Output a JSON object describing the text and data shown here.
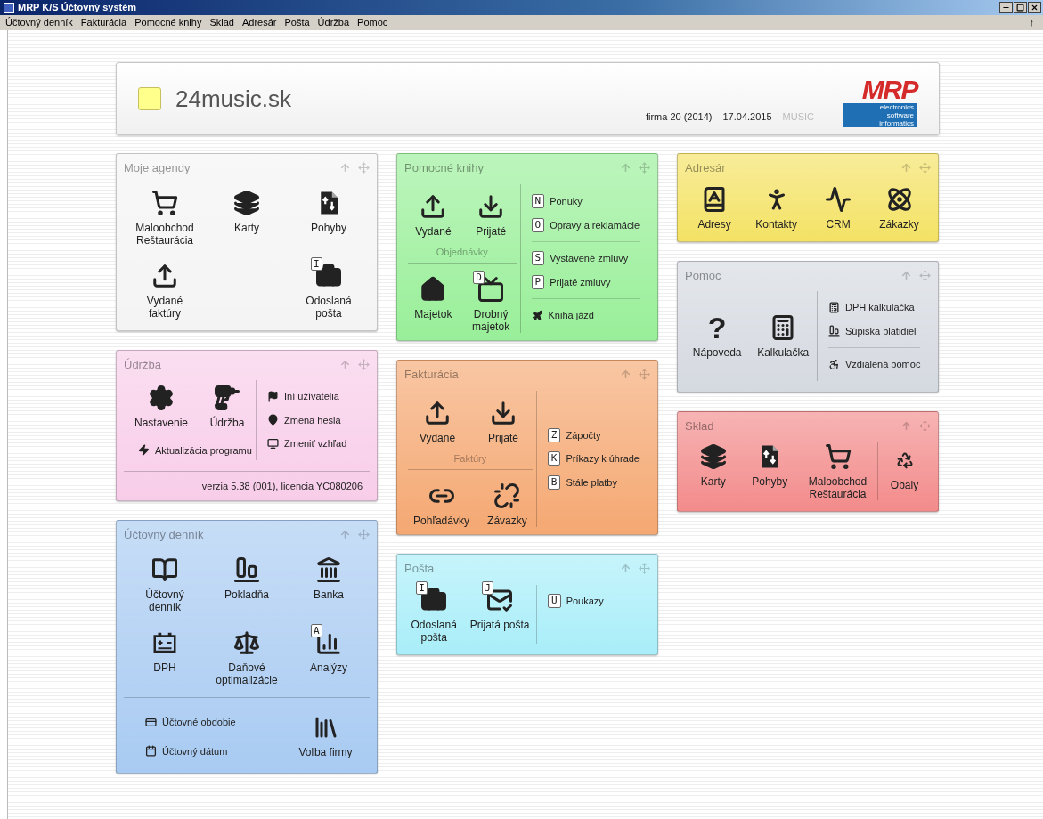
{
  "window": {
    "title": "MRP K/S Účtovný systém"
  },
  "menu": [
    {
      "label": "Účtovný denník"
    },
    {
      "label": "Fakturácia"
    },
    {
      "label": "Pomocné knihy"
    },
    {
      "label": "Sklad"
    },
    {
      "label": "Adresár"
    },
    {
      "label": "Pošta"
    },
    {
      "label": "Údržba"
    },
    {
      "label": "Pomoc"
    }
  ],
  "menu_arrow": "↑",
  "header": {
    "company": "24music.sk",
    "firm": "firma 20 (2014)",
    "date": "17.04.2015",
    "user": "MUSIC",
    "logo": {
      "name": "MRP",
      "lines": [
        "electronics",
        "software",
        "informatics"
      ]
    }
  },
  "columns": [
    [
      {
        "title": "Moje agendy",
        "color": "#f4f4f4",
        "kind": "grid",
        "tiles": [
          {
            "kind": "tile",
            "label": "Maloobchod\nReštaurácia"
          },
          {
            "kind": "tile",
            "label": "Karty"
          },
          {
            "kind": "tile",
            "label": "Pohyby"
          },
          {
            "kind": "tile",
            "label": "Vydané\nfaktúry"
          },
          {
            "kind": "blank"
          },
          {
            "kind": "tile",
            "label": "Odoslaná\npošta",
            "badge": "I"
          }
        ]
      },
      {
        "title": "Údržba",
        "color": "#f8cde9",
        "kind": "row",
        "tiles": [
          {
            "label": "Nastavenie"
          },
          {
            "label": "Údržba"
          }
        ],
        "links": [
          {
            "label": "Aktualizácia programu"
          }
        ],
        "groups": [
          [
            {
              "label": "Iní užívatelia"
            },
            {
              "label": "Zmena hesla"
            },
            {
              "label": "Zmeniť vzhľad"
            }
          ]
        ],
        "footer": "verzia 5.38 (001), licencia YC080206"
      },
      {
        "title": "Účtovný denník",
        "color": "#a9cbf2",
        "kind": "grid",
        "tiles": [
          {
            "label": "Účtovný\ndenník"
          },
          {
            "label": "Pokladňa"
          },
          {
            "label": "Banka"
          },
          {
            "label": "DPH"
          },
          {
            "label": "Daňové\noptimalizácie"
          },
          {
            "label": "Analýzy",
            "badge": "A"
          }
        ],
        "links": [
          {
            "label": "Účtovné obdobie"
          },
          {
            "label": "Účtovný dátum"
          }
        ],
        "side_tiles": [
          {
            "label": "Voľba firmy"
          }
        ]
      }
    ],
    [
      {
        "title": "Pomocné knihy",
        "color": "#99ef99",
        "kind": "split",
        "tiles": [
          {
            "label": "Vydané"
          },
          {
            "label": "Prijaté"
          }
        ],
        "caption": "Objednávky",
        "tiles2": [
          {
            "label": "Majetok"
          },
          {
            "label": "Drobný\nmajetok",
            "badge": "D"
          }
        ],
        "groups": [
          [
            {
              "key": "N",
              "label": "Ponuky"
            },
            {
              "key": "O",
              "label": "Opravy a reklamácie"
            }
          ],
          [
            {
              "key": "S",
              "label": "Vystavené zmluvy"
            },
            {
              "key": "P",
              "label": "Prijaté zmluvy"
            }
          ],
          [
            {
              "label": "Kniha jázd"
            }
          ]
        ]
      },
      {
        "title": "Fakturácia",
        "color": "#f5a872",
        "kind": "split",
        "tiles": [
          {
            "label": "Vydané"
          },
          {
            "label": "Prijaté"
          }
        ],
        "caption": "Faktúry",
        "tiles2": [
          {
            "label": "Pohľadávky"
          },
          {
            "label": "Závazky"
          }
        ],
        "groups": [
          [
            {
              "key": "Z",
              "label": "Zápočty"
            },
            {
              "key": "K",
              "label": "Príkazy k úhrade"
            },
            {
              "key": "B",
              "label": "Stále platby"
            }
          ]
        ]
      },
      {
        "title": "Pošta",
        "color": "#a9eef9",
        "kind": "row",
        "tiles": [
          {
            "label": "Odoslaná\npošta",
            "badge": "I"
          },
          {
            "label": "Prijatá pošta",
            "badge": "J"
          }
        ],
        "groups": [
          [
            {
              "key": "U",
              "label": "Poukazy"
            }
          ]
        ]
      }
    ],
    [
      {
        "title": "Adresár",
        "color": "#f4e264",
        "kind": "row",
        "tiles": [
          {
            "label": "Adresy"
          },
          {
            "label": "Kontakty"
          },
          {
            "label": "CRM"
          },
          {
            "label": "Zákazky"
          }
        ]
      },
      {
        "title": "Pomoc",
        "color": "#d5d9e0",
        "kind": "row",
        "tiles": [
          {
            "glyph": "?",
            "label": "Nápoveda"
          },
          {
            "label": "Kalkulačka"
          }
        ],
        "groups": [
          [
            {
              "label": "DPH kalkulačka"
            },
            {
              "label": "Súpiska platidiel"
            }
          ],
          [
            {
              "label": "Vzdialená pomoc"
            }
          ]
        ]
      },
      {
        "title": "Sklad",
        "color": "#f38b8b",
        "kind": "row",
        "tiles": [
          {
            "label": "Karty"
          },
          {
            "label": "Pohyby"
          },
          {
            "label": "Maloobchod\nReštaurácia"
          }
        ],
        "side_tiles": [
          {
            "label": "Obaly"
          }
        ]
      }
    ]
  ]
}
